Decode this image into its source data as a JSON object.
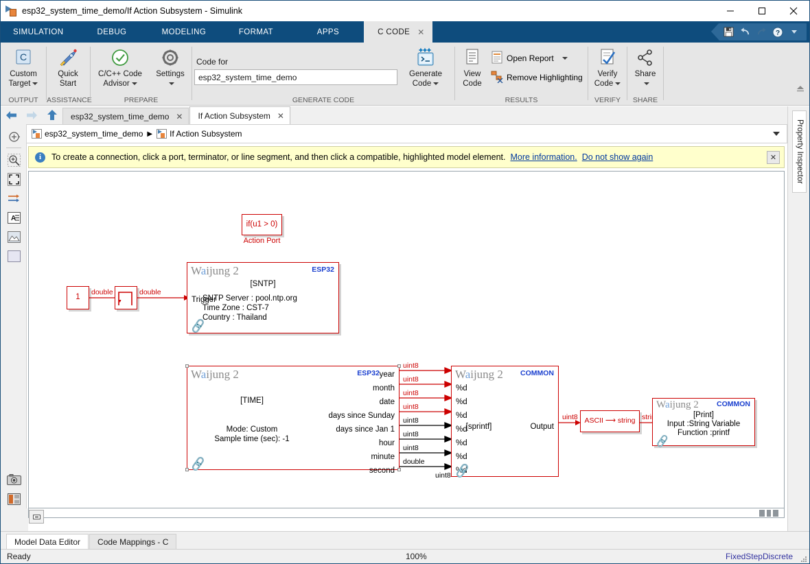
{
  "window": {
    "title": "esp32_system_time_demo/If Action Subsystem - Simulink",
    "minimize": "—",
    "maximize": "☐",
    "close": "✕"
  },
  "ribbon_tabs": [
    {
      "label": "SIMULATION",
      "active": false
    },
    {
      "label": "DEBUG",
      "active": false
    },
    {
      "label": "MODELING",
      "active": false
    },
    {
      "label": "FORMAT",
      "active": false
    },
    {
      "label": "APPS",
      "active": false
    },
    {
      "label": "C CODE",
      "active": true,
      "close": "✕"
    }
  ],
  "quick_access": [
    {
      "name": "save-icon",
      "glyph": "💾"
    },
    {
      "name": "undo-icon",
      "glyph": "↶"
    },
    {
      "name": "redo-icon",
      "glyph": "↷"
    },
    {
      "name": "help-icon",
      "glyph": "?"
    }
  ],
  "ribbon": {
    "groups": [
      {
        "label": "OUTPUT"
      },
      {
        "label": "ASSISTANCE"
      },
      {
        "label": "PREPARE"
      },
      {
        "label": "GENERATE CODE"
      },
      {
        "label": "RESULTS"
      },
      {
        "label": "VERIFY"
      },
      {
        "label": "SHARE"
      }
    ],
    "custom_target": "Custom\nTarget",
    "custom_target_l1": "Custom",
    "custom_target_l2": "Target",
    "quick_start_l1": "Quick",
    "quick_start_l2": "Start",
    "code_advisor_l1": "C/C++ Code",
    "code_advisor_l2": "Advisor",
    "settings_l1": "Settings",
    "generate_code_l1": "Generate",
    "generate_code_l2": "Code",
    "view_code_l1": "View",
    "view_code_l2": "Code",
    "open_report": "Open Report",
    "remove_highlighting": "Remove Highlighting",
    "verify_code_l1": "Verify",
    "verify_code_l2": "Code",
    "share_l1": "Share",
    "code_for_label": "Code for",
    "code_for_value": "esp32_system_time_demo"
  },
  "model_tabs": [
    {
      "label": "esp32_system_time_demo",
      "close": "✕",
      "active": false
    },
    {
      "label": "If Action Subsystem",
      "close": "✕",
      "active": true
    }
  ],
  "breadcrumb": [
    {
      "label": "esp32_system_time_demo"
    },
    {
      "label": "If Action Subsystem"
    }
  ],
  "breadcrumb_separator": "▶",
  "notification": {
    "text": "To create a connection, click a port, terminator, or line segment, and then click a compatible, highlighted model element.",
    "link1": "More information.",
    "link2": "Do not show again",
    "close": "✕",
    "info": "i"
  },
  "rail_icons": [
    {
      "name": "fit-to-view-icon"
    },
    {
      "name": "zoom-in-icon"
    },
    {
      "name": "fit-to-screen-icon"
    },
    {
      "name": "signal-routing-icon"
    },
    {
      "name": "annotation-icon"
    },
    {
      "name": "image-icon"
    },
    {
      "name": "area-icon"
    },
    {
      "name": "camera-icon"
    },
    {
      "name": "layout-icon"
    },
    {
      "name": "more-icon"
    }
  ],
  "diagram": {
    "action_port": {
      "condition": "if(u1 > 0)",
      "label": "Action Port"
    },
    "constant": {
      "value": "1"
    },
    "const_signal": "double",
    "step_signal": "double",
    "sntp_block": {
      "brand": "Waijung 2",
      "chip": "ESP32",
      "tag": "[SNTP]",
      "line1": "SNTP Server : pool.ntp.org",
      "line2": "Time Zone : CST-7",
      "line3": "Country : Thailand",
      "inport": "Trigger"
    },
    "time_block": {
      "brand": "Waijung 2",
      "chip": "ESP32",
      "tag": "[TIME]",
      "mode": "Mode: Custom",
      "sample": "Sample time (sec): -1",
      "outports": [
        {
          "label": "year",
          "type": "uint8"
        },
        {
          "label": "month",
          "type": "uint8"
        },
        {
          "label": "date",
          "type": "uint8"
        },
        {
          "label": "days since Sunday",
          "type": "uint8"
        },
        {
          "label": "days since Jan 1",
          "type": "uint8"
        },
        {
          "label": "hour",
          "type": "uint8"
        },
        {
          "label": "minute",
          "type": "uint8"
        },
        {
          "label": "second",
          "type": "double"
        }
      ]
    },
    "sprintf_block": {
      "brand": "Waijung 2",
      "chip": "COMMON",
      "tag": "[sprintf]",
      "outport": "Output",
      "out_signal": "uint8",
      "in_signal_bottom": "uint8",
      "inports": [
        "%d",
        "%d",
        "%d",
        "%d",
        "%d",
        "%d",
        "%d"
      ]
    },
    "ascii_block": {
      "label_left": "ASCII",
      "label_arrow": "⟶",
      "label_right": "string",
      "out_signal": "string"
    },
    "print_block": {
      "brand": "Waijung 2",
      "chip": "COMMON",
      "tag": "[Print]",
      "line1": "Input :String Variable",
      "line2": "Function :printf"
    }
  },
  "bottom_tabs": [
    {
      "label": "Model Data Editor",
      "active": true
    },
    {
      "label": "Code Mappings - C",
      "active": false
    }
  ],
  "status": {
    "ready": "Ready",
    "zoom": "100%",
    "solver": "FixedStepDiscrete"
  },
  "property_inspector": {
    "label": "Property Inspector"
  },
  "colors": {
    "ribbon_blue": "#0e4c7d",
    "block_red": "#cc0000",
    "chip_blue": "#1a3fcf",
    "notif_bg": "#ffffcc",
    "link": "#00389e",
    "solver": "#3333a0"
  }
}
